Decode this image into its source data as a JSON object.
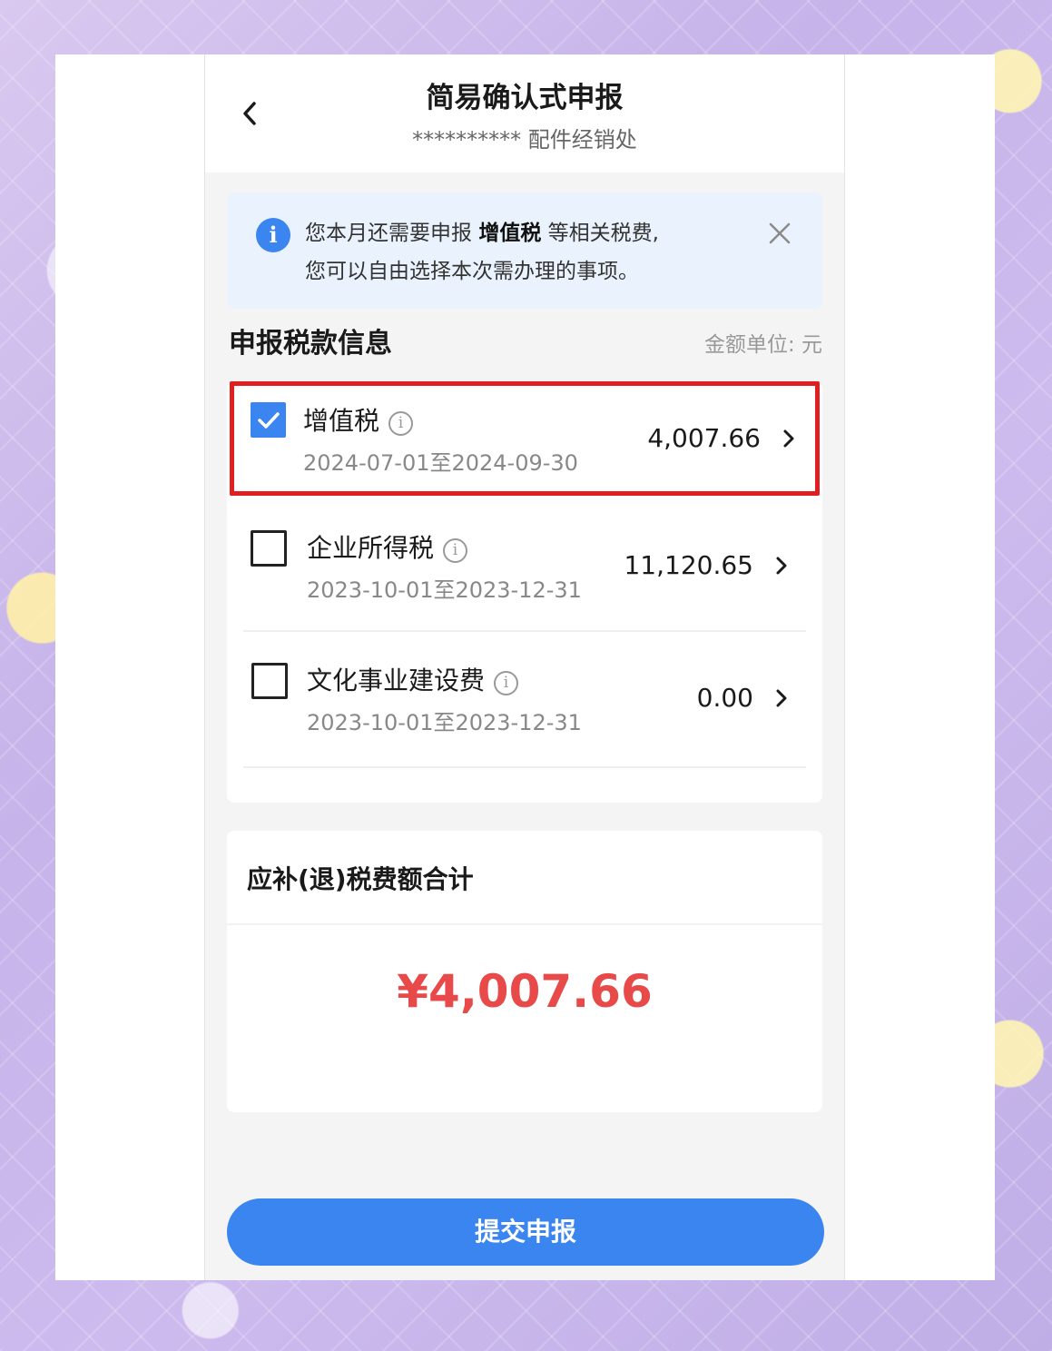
{
  "header": {
    "title": "简易确认式申报",
    "subtitle": "********** 配件经销处"
  },
  "notice": {
    "text_prefix": "您本月还需要申报 ",
    "text_bold": "增值税",
    "text_suffix": " 等相关税费,",
    "text_line2": "您可以自由选择本次需办理的事项。"
  },
  "section": {
    "title": "申报税款信息",
    "unit": "金额单位: 元"
  },
  "taxes": [
    {
      "name": "增值税",
      "period": "2024-07-01至2024-09-30",
      "amount": "4,007.66",
      "checked": true
    },
    {
      "name": "企业所得税",
      "period": "2023-10-01至2023-12-31",
      "amount": "11,120.65",
      "checked": false
    },
    {
      "name": "文化事业建设费",
      "period": "2023-10-01至2023-12-31",
      "amount": "0.00",
      "checked": false
    }
  ],
  "total": {
    "label": "应补(退)税费额合计",
    "amount": "¥4,007.66"
  },
  "actions": {
    "submit_label": "提交申报"
  },
  "colors": {
    "accent": "#3a85f0",
    "highlight": "#e02020",
    "amount_red": "#e84a4a"
  }
}
